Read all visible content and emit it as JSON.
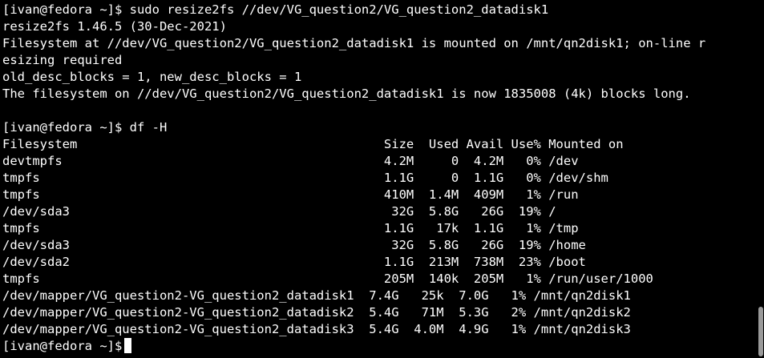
{
  "terminal": {
    "lines": [
      "[ivan@fedora ~]$ sudo resize2fs //dev/VG_question2/VG_question2_datadisk1",
      "resize2fs 1.46.5 (30-Dec-2021)",
      "Filesystem at //dev/VG_question2/VG_question2_datadisk1 is mounted on /mnt/qn2disk1; on-line r",
      "esizing required",
      "old_desc_blocks = 1, new_desc_blocks = 1",
      "The filesystem on //dev/VG_question2/VG_question2_datadisk1 is now 1835008 (4k) blocks long.",
      "",
      "[ivan@fedora ~]$ df -H",
      "Filesystem                                         Size  Used Avail Use% Mounted on",
      "devtmpfs                                           4.2M     0  4.2M   0% /dev",
      "tmpfs                                              1.1G     0  1.1G   0% /dev/shm",
      "tmpfs                                              410M  1.4M  409M   1% /run",
      "/dev/sda3                                           32G  5.8G   26G  19% /",
      "tmpfs                                              1.1G   17k  1.1G   1% /tmp",
      "/dev/sda3                                           32G  5.8G   26G  19% /home",
      "/dev/sda2                                          1.1G  213M  738M  23% /boot",
      "tmpfs                                              205M  140k  205M   1% /run/user/1000",
      "/dev/mapper/VG_question2-VG_question2_datadisk1  7.4G   25k  7.0G   1% /mnt/qn2disk1",
      "/dev/mapper/VG_question2-VG_question2_datadisk2  5.4G   71M  5.3G   2% /mnt/qn2disk2",
      "/dev/mapper/VG_question2-VG_question2_datadisk3  5.4G  4.0M  4.9G   1% /mnt/qn2disk3"
    ],
    "prompt": "[ivan@fedora ~]$"
  }
}
